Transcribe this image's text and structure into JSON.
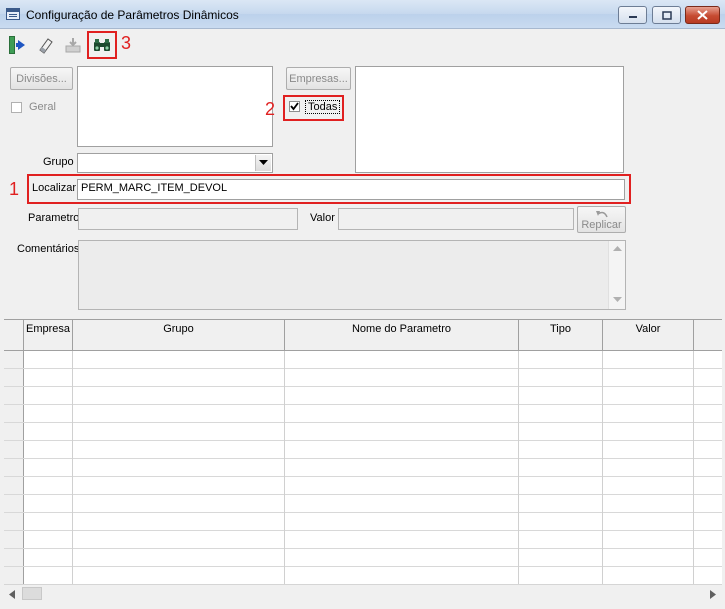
{
  "window": {
    "title": "Configuração de Parâmetros Dinâmicos"
  },
  "annotations": {
    "m1": "1",
    "m2": "2",
    "m3": "3"
  },
  "form": {
    "divisoes_label": "Divisões...",
    "geral_label": "Geral",
    "empresas_label": "Empresas...",
    "todas_label": "Todas",
    "grupo_label": "Grupo",
    "grupo_value": "",
    "localizar_label": "Localizar",
    "localizar_value": "PERM_MARC_ITEM_DEVOL",
    "parametro_label": "Parametro",
    "valor_label": "Valor",
    "replicar_label": "Replicar",
    "comentarios_label": "Comentários"
  },
  "grid": {
    "columns": [
      "Empresa",
      "Grupo",
      "Nome do Parametro",
      "Tipo",
      "Valor"
    ]
  },
  "colors": {
    "highlight": "#e02020"
  }
}
